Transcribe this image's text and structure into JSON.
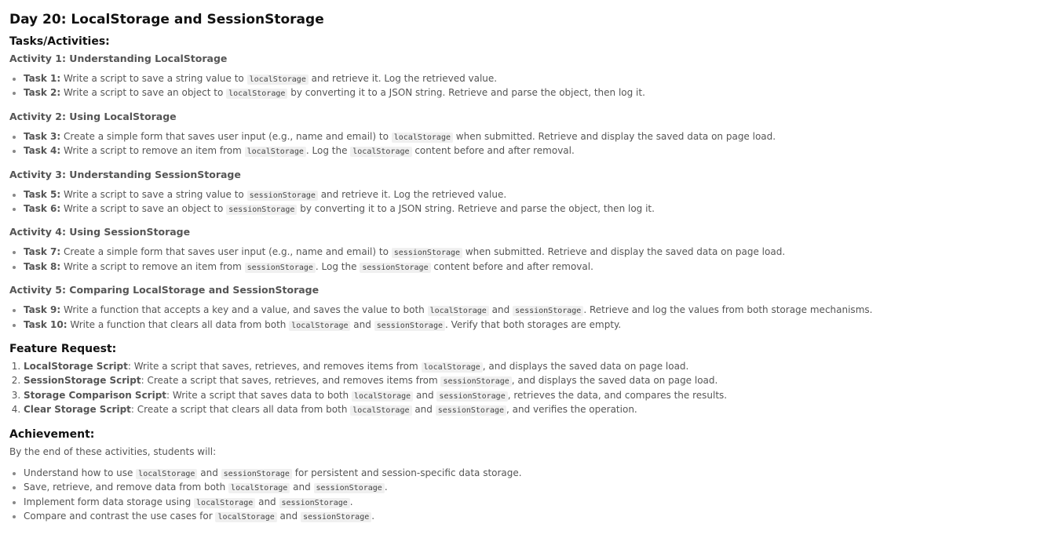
{
  "title": "Day 20: LocalStorage and SessionStorage",
  "tasks_heading": "Tasks/Activities:",
  "activities": [
    {
      "heading": "Activity 1: Understanding LocalStorage",
      "items": [
        {
          "label": "Task 1:",
          "parts": [
            "Write a script to save a string value to ",
            "localStorage",
            " and retrieve it. Log the retrieved value."
          ]
        },
        {
          "label": "Task 2:",
          "parts": [
            "Write a script to save an object to ",
            "localStorage",
            " by converting it to a JSON string. Retrieve and parse the object, then log it."
          ]
        }
      ]
    },
    {
      "heading": "Activity 2: Using LocalStorage",
      "items": [
        {
          "label": "Task 3:",
          "parts": [
            "Create a simple form that saves user input (e.g., name and email) to ",
            "localStorage",
            " when submitted. Retrieve and display the saved data on page load."
          ]
        },
        {
          "label": "Task 4:",
          "parts": [
            "Write a script to remove an item from ",
            "localStorage",
            ". Log the ",
            "localStorage",
            " content before and after removal."
          ]
        }
      ]
    },
    {
      "heading": "Activity 3: Understanding SessionStorage",
      "items": [
        {
          "label": "Task 5:",
          "parts": [
            "Write a script to save a string value to ",
            "sessionStorage",
            " and retrieve it. Log the retrieved value."
          ]
        },
        {
          "label": "Task 6:",
          "parts": [
            "Write a script to save an object to ",
            "sessionStorage",
            " by converting it to a JSON string. Retrieve and parse the object, then log it."
          ]
        }
      ]
    },
    {
      "heading": "Activity 4: Using SessionStorage",
      "items": [
        {
          "label": "Task 7:",
          "parts": [
            "Create a simple form that saves user input (e.g., name and email) to ",
            "sessionStorage",
            " when submitted. Retrieve and display the saved data on page load."
          ]
        },
        {
          "label": "Task 8:",
          "parts": [
            "Write a script to remove an item from ",
            "sessionStorage",
            ". Log the ",
            "sessionStorage",
            " content before and after removal."
          ]
        }
      ]
    },
    {
      "heading": "Activity 5: Comparing LocalStorage and SessionStorage",
      "items": [
        {
          "label": "Task 9:",
          "parts": [
            "Write a function that accepts a key and a value, and saves the value to both ",
            "localStorage",
            " and ",
            "sessionStorage",
            ". Retrieve and log the values from both storage mechanisms."
          ]
        },
        {
          "label": "Task 10:",
          "parts": [
            "Write a function that clears all data from both ",
            "localStorage",
            " and ",
            "sessionStorage",
            ". Verify that both storages are empty."
          ]
        }
      ]
    }
  ],
  "feature_request": {
    "heading": "Feature Request:",
    "items": [
      {
        "label": "LocalStorage Script",
        "parts": [
          ": Write a script that saves, retrieves, and removes items from ",
          "localStorage",
          ", and displays the saved data on page load."
        ]
      },
      {
        "label": "SessionStorage Script",
        "parts": [
          ": Create a script that saves, retrieves, and removes items from ",
          "sessionStorage",
          ", and displays the saved data on page load."
        ]
      },
      {
        "label": "Storage Comparison Script",
        "parts": [
          ": Write a script that saves data to both ",
          "localStorage",
          " and ",
          "sessionStorage",
          ", retrieves the data, and compares the results."
        ]
      },
      {
        "label": "Clear Storage Script",
        "parts": [
          ": Create a script that clears all data from both ",
          "localStorage",
          " and ",
          "sessionStorage",
          ", and verifies the operation."
        ]
      }
    ]
  },
  "achievement": {
    "heading": "Achievement:",
    "intro": "By the end of these activities, students will:",
    "items": [
      {
        "parts": [
          "Understand how to use ",
          "localStorage",
          " and ",
          "sessionStorage",
          " for persistent and session-specific data storage."
        ]
      },
      {
        "parts": [
          "Save, retrieve, and remove data from both ",
          "localStorage",
          " and ",
          "sessionStorage",
          "."
        ]
      },
      {
        "parts": [
          "Implement form data storage using ",
          "localStorage",
          " and ",
          "sessionStorage",
          "."
        ]
      },
      {
        "parts": [
          "Compare and contrast the use cases for ",
          "localStorage",
          " and ",
          "sessionStorage",
          "."
        ]
      }
    ]
  }
}
